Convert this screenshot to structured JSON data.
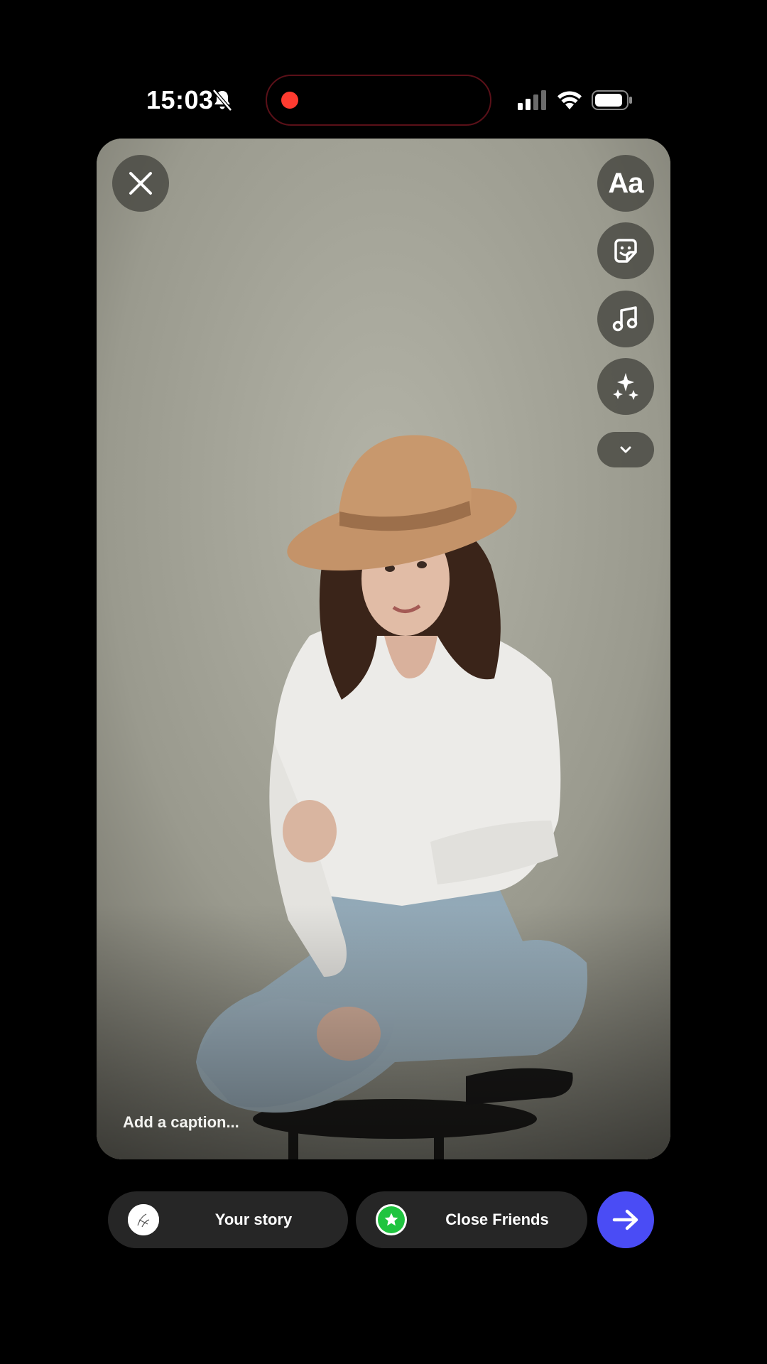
{
  "status_bar": {
    "time": "15:03",
    "icons": [
      "bell-muted-icon",
      "recording-dot-icon",
      "cellular-signal-icon",
      "wifi-icon",
      "battery-icon"
    ],
    "recording_color": "#ff3b30"
  },
  "editor": {
    "close_icon": "close-icon",
    "tools": [
      {
        "name": "text-tool",
        "label": "Aa"
      },
      {
        "name": "sticker-tool",
        "icon": "sticker-icon"
      },
      {
        "name": "music-tool",
        "icon": "music-note-icon"
      },
      {
        "name": "effects-tool",
        "icon": "sparkles-icon"
      },
      {
        "name": "more-tools",
        "icon": "chevron-down-icon"
      }
    ],
    "caption_placeholder": "Add a caption..."
  },
  "share": {
    "your_story_label": "Your story",
    "close_friends_label": "Close Friends",
    "close_friends_color": "#1fc43f",
    "send_button_color": "#4a4cf5",
    "send_icon": "arrow-right-icon"
  }
}
